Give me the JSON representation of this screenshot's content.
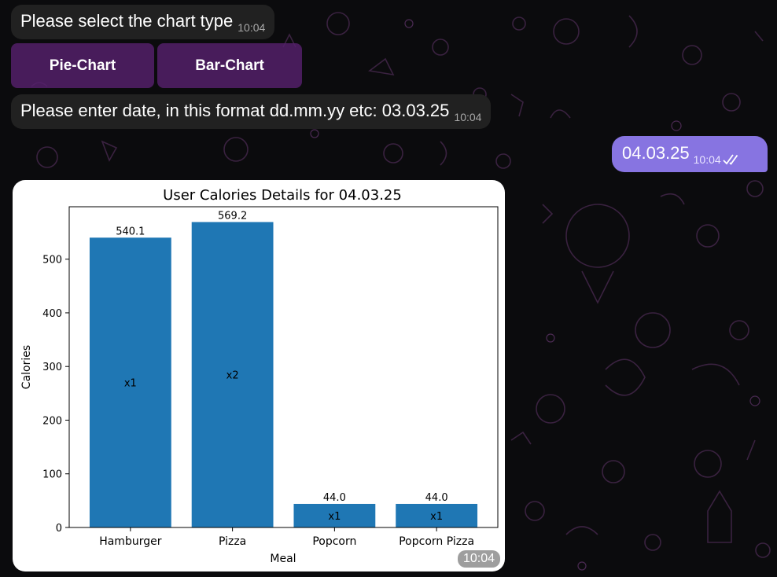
{
  "messages": {
    "select_prompt": {
      "text": "Please select the chart type",
      "time": "10:04"
    },
    "date_prompt": {
      "text": "Please enter date, in this format dd.mm.yy etc: 03.03.25",
      "time": "10:04"
    },
    "user_reply": {
      "text": "04.03.25",
      "time": "10:04",
      "status_icon": "double-check-icon"
    },
    "chart_message": {
      "time": "10:04"
    }
  },
  "keyboard": {
    "pie_label": "Pie-Chart",
    "bar_label": "Bar-Chart"
  },
  "colors": {
    "background": "#0b0b0d",
    "incoming_bubble": "#212121",
    "outgoing_bubble": "#8774e1",
    "keyboard_button": "#56206c",
    "bar": "#1f77b4"
  },
  "chart_data": {
    "type": "bar",
    "title": "User Calories Details for 04.03.25",
    "xlabel": "Meal",
    "ylabel": "Calories",
    "categories": [
      "Hamburger",
      "Pizza",
      "Popcorn",
      "Popcorn Pizza"
    ],
    "values": [
      540.1,
      569.2,
      44.0,
      44.0
    ],
    "value_labels": [
      "540.1",
      "569.2",
      "44.0",
      "44.0"
    ],
    "count_labels": [
      "x1",
      "x2",
      "x1",
      "x1"
    ],
    "yticks": [
      0,
      100,
      200,
      300,
      400,
      500
    ],
    "ylim": [
      0,
      597.7
    ],
    "grid": false,
    "legend": "none"
  }
}
